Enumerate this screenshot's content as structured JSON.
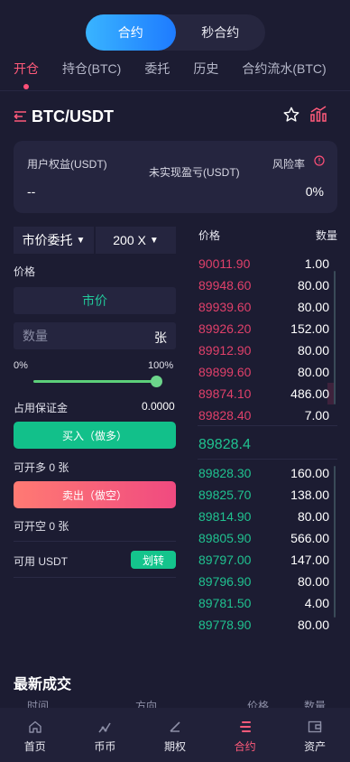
{
  "mode_toggle": {
    "options": [
      "合约",
      "秒合约"
    ],
    "active": 0
  },
  "tabs": [
    "开仓",
    "持仓(BTC)",
    "委托",
    "历史",
    "合约流水(BTC)"
  ],
  "pair": "BTC/USDT",
  "account": {
    "equity_label": "用户权益(USDT)",
    "equity_value": "--",
    "unrealized_label": "未实现盈亏(USDT)",
    "risk_label": "风险率",
    "risk_value": "0%"
  },
  "order_form": {
    "order_type": "市价委托",
    "leverage": "200 X",
    "price_label": "价格",
    "price_value": "市价",
    "quantity_placeholder": "数量",
    "quantity_unit": "张",
    "slider_min": "0%",
    "slider_max": "100%",
    "slider_level": 1.0,
    "margin_label": "占用保证金",
    "margin_value": "0.0000",
    "buy_label": "买入（做多）",
    "long_capacity": "可开多 0 张",
    "sell_label": "卖出（做空）",
    "short_capacity": "可开空 0 张",
    "available_label": "可用 USDT",
    "transfer_label": "划转"
  },
  "orderbook": {
    "price_header": "价格",
    "qty_header": "数量",
    "asks": [
      {
        "price": "90011.90",
        "qty": "1.00",
        "depth": 0.0
      },
      {
        "price": "89948.60",
        "qty": "80.00",
        "depth": 0.0
      },
      {
        "price": "89939.60",
        "qty": "80.00",
        "depth": 0.0
      },
      {
        "price": "89926.20",
        "qty": "152.00",
        "depth": 0.0
      },
      {
        "price": "89912.90",
        "qty": "80.00",
        "depth": 0.0
      },
      {
        "price": "89899.60",
        "qty": "80.00",
        "depth": 0.0
      },
      {
        "price": "89874.10",
        "qty": "486.00",
        "depth": 0.05
      },
      {
        "price": "89828.40",
        "qty": "7.00",
        "depth": 0.0
      }
    ],
    "last_price": "89828.4",
    "bids": [
      {
        "price": "89828.30",
        "qty": "160.00",
        "depth": 0.0
      },
      {
        "price": "89825.70",
        "qty": "138.00",
        "depth": 0.0
      },
      {
        "price": "89814.90",
        "qty": "80.00",
        "depth": 0.0
      },
      {
        "price": "89805.90",
        "qty": "566.00",
        "depth": 0.0
      },
      {
        "price": "89797.00",
        "qty": "147.00",
        "depth": 0.0
      },
      {
        "price": "89796.90",
        "qty": "80.00",
        "depth": 0.0
      },
      {
        "price": "89781.50",
        "qty": "4.00",
        "depth": 0.0
      },
      {
        "price": "89778.90",
        "qty": "80.00",
        "depth": 0.0
      }
    ]
  },
  "latest_trades": {
    "title": "最新成交",
    "headers": [
      "时间",
      "方向",
      "价格",
      "数量"
    ]
  },
  "bottom_nav": {
    "items": [
      {
        "label": "首页",
        "icon": "home-icon"
      },
      {
        "label": "币币",
        "icon": "spot-trade-icon"
      },
      {
        "label": "期权",
        "icon": "options-icon"
      },
      {
        "label": "合约",
        "icon": "futures-icon"
      },
      {
        "label": "资产",
        "icon": "wallet-icon"
      }
    ],
    "active": 3
  },
  "colors": {
    "accent": "#ff5a7a",
    "up": "#20c290",
    "down": "#e0406a",
    "background": "#1c1c32"
  }
}
